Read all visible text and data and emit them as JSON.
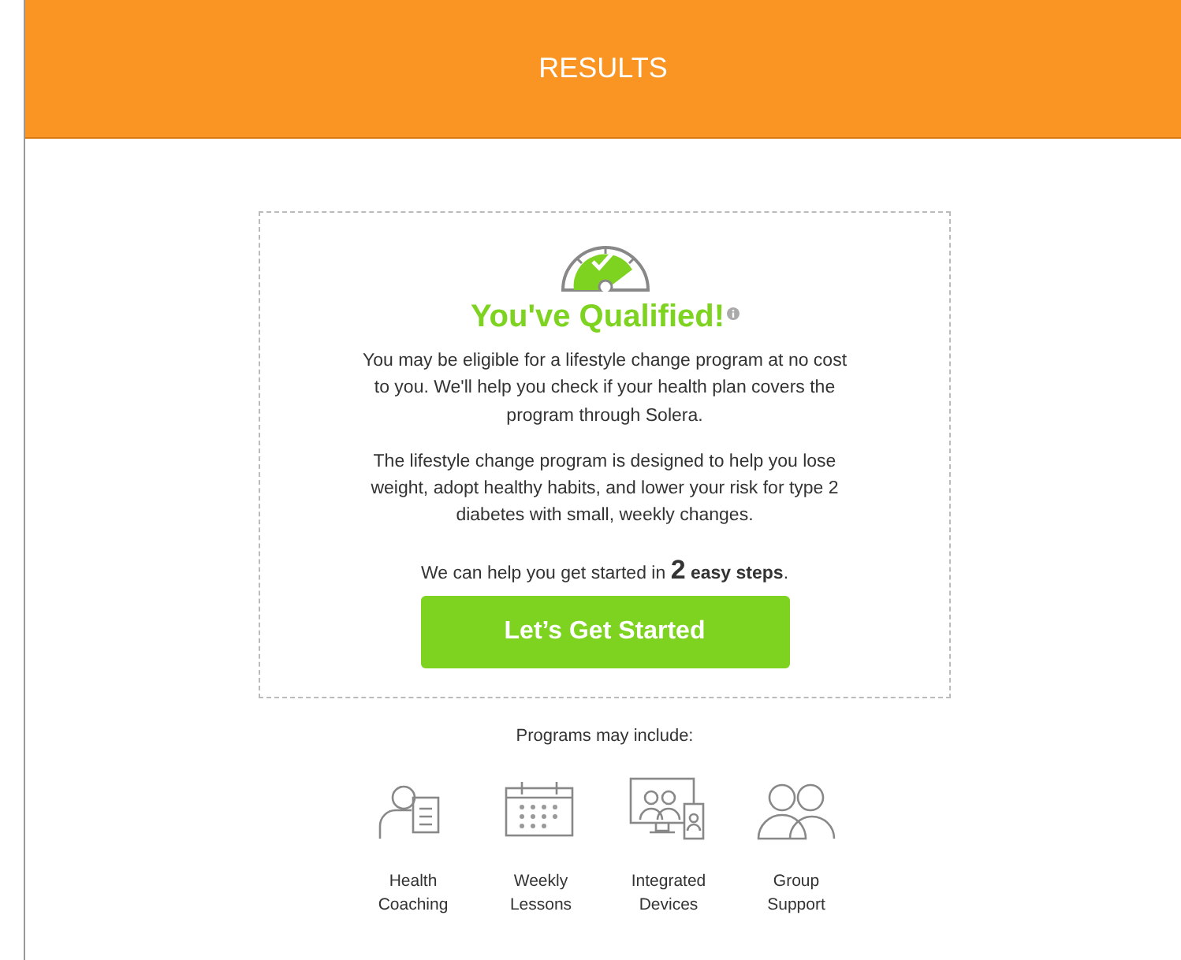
{
  "header": {
    "title": "RESULTS"
  },
  "result": {
    "heading": "You've Qualified!",
    "info_icon": true,
    "paragraphs": [
      "You may be eligible for a lifestyle change program at no cost to you. We'll help you check if your health plan covers the program through Solera.",
      "The lifestyle change program is designed to help you lose weight, adopt healthy habits, and lower your risk for type 2 diabetes with small, weekly changes."
    ],
    "steps_text": "We can help you get started in **2** **easy steps**.",
    "button": "Let’s Get Started"
  },
  "programs": {
    "intro": "Programs may include:",
    "items": [
      {
        "kind": "coaching",
        "label": "Health Coaching"
      },
      {
        "kind": "calendar",
        "label": "Weekly Lessons"
      },
      {
        "kind": "devices",
        "label": "Integrated Devices"
      },
      {
        "kind": "group",
        "label": "Group Support"
      }
    ]
  }
}
